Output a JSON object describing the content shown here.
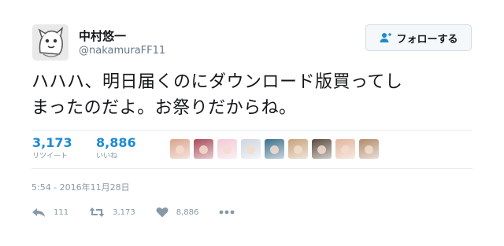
{
  "user": {
    "display_name": "中村悠一",
    "handle": "@nakamuraFF11"
  },
  "follow_button": {
    "label": "フォローする",
    "icon": "follow-user-icon"
  },
  "tweet": {
    "text_line1": "ハハハ、明日届くのにダウンロード版買ってし",
    "text_line2": "まったのだよ。お祭りだからね。",
    "timestamp": "5:54 - 2016年11月28日"
  },
  "stats": {
    "retweets": {
      "count": "3,173",
      "label": "リツイート"
    },
    "likes": {
      "count": "8,886",
      "label": "いいね"
    }
  },
  "likers": [
    {
      "icon": "liker-avatar-1",
      "color": "#d9a38c"
    },
    {
      "icon": "liker-avatar-2",
      "color": "#a84a5a"
    },
    {
      "icon": "liker-avatar-3",
      "color": "#f2c9d6"
    },
    {
      "icon": "liker-avatar-4",
      "color": "#cfd6e0"
    },
    {
      "icon": "liker-avatar-5",
      "color": "#3b6f8c"
    },
    {
      "icon": "liker-avatar-6",
      "color": "#c7a17a"
    },
    {
      "icon": "liker-avatar-7",
      "color": "#5a4a3e"
    },
    {
      "icon": "liker-avatar-8",
      "color": "#e3b39a"
    },
    {
      "icon": "liker-avatar-9",
      "color": "#b08a6a"
    }
  ],
  "actions": {
    "reply": {
      "count": "111",
      "icon": "reply-icon"
    },
    "retweet": {
      "count": "3,173",
      "icon": "retweet-icon"
    },
    "like": {
      "count": "8,886",
      "icon": "heart-icon"
    },
    "more": {
      "icon": "more-icon"
    }
  },
  "colors": {
    "accent": "#1d8ad0",
    "muted": "#8899a6",
    "text": "#14171a",
    "border": "#e6ecf0"
  }
}
